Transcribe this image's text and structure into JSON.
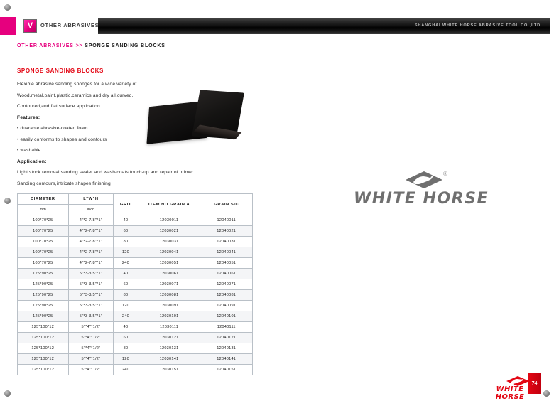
{
  "header": {
    "tab_icon_letter": "V",
    "tab_label": "OTHER ABRASIVES",
    "company": "SHANGHAI WHITE HORSE ABRASIVE TOOL CO.,LTD"
  },
  "breadcrumb": {
    "parent": "OTHER ABRASIVES",
    "separator": ">>",
    "current": "SPONGE SANDING BLOCKS"
  },
  "content": {
    "section_title": "SPONGE SANDING BLOCKS",
    "intro_line_1": "Flexible abrasive sanding sponges for a wide variety of",
    "intro_line_2": "Wood,metal,paint,plastic,ceramics and dry all,curved,",
    "intro_line_3": "Contoured,and flat surface application.",
    "features_heading": "Features:",
    "feature_1": "• duarable abrasive-coated foam",
    "feature_2": "• easily conforms to shapes and contours",
    "feature_3": "• washable",
    "application_heading": "Application:",
    "application_line_1": "Light stock removal,sanding sealer and wash-coats touch-up and repair of primer",
    "application_line_2": "Sanding contours,intricate shapes finishing"
  },
  "table": {
    "headers": [
      "DIAMETER",
      "L\"W\"H",
      "GRIT",
      "ITEM.NO.GRAIN  A",
      "GRAIN SIC"
    ],
    "subheaders": [
      "mm",
      "inch"
    ],
    "rows": [
      [
        "100*70*25",
        "4\"*2-7/8\"*1\"",
        "40",
        "12030011",
        "12040011"
      ],
      [
        "100*70*25",
        "4\"*2-7/8\"*1\"",
        "60",
        "12030021",
        "12040021"
      ],
      [
        "100*70*25",
        "4\"*2-7/8\"*1\"",
        "80",
        "12030031",
        "12040031"
      ],
      [
        "100*70*25",
        "4\"*2-7/8\"*1\"",
        "120",
        "12030041",
        "12040041"
      ],
      [
        "100*70*25",
        "4\"*2-7/8\"*1\"",
        "240",
        "12030051",
        "12040051"
      ],
      [
        "125*90*25",
        "5\"*3-3/5\"*1\"",
        "40",
        "12030061",
        "12040061"
      ],
      [
        "125*90*25",
        "5\"*3-3/5\"*1\"",
        "60",
        "12030071",
        "12040071"
      ],
      [
        "125*90*25",
        "5\"*3-3/5\"*1\"",
        "80",
        "12030081",
        "12040081"
      ],
      [
        "125*90*25",
        "5\"*3-3/5\"*1\"",
        "120",
        "12030091",
        "12040091"
      ],
      [
        "125*90*25",
        "5\"*3-3/5\"*1\"",
        "240",
        "12030101",
        "12040101"
      ],
      [
        "125*100*12",
        "5\"*4\"*1/2\"",
        "40",
        "12030111",
        "12040111"
      ],
      [
        "125*100*12",
        "5\"*4\"*1/2\"",
        "60",
        "12030121",
        "12040121"
      ],
      [
        "125*100*12",
        "5\"*4\"*1/2\"",
        "80",
        "12030131",
        "12040131"
      ],
      [
        "125*100*12",
        "5\"*4\"*1/2\"",
        "120",
        "12030141",
        "12040141"
      ],
      [
        "125*100*12",
        "5\"*4\"*1/2\"",
        "240",
        "12030151",
        "12040151"
      ]
    ]
  },
  "brand": {
    "wordmark": "WHITE HORSE",
    "registered": "®"
  },
  "footer": {
    "wordmark": "WHITE HORSE",
    "registered": "®",
    "page_number": "74"
  },
  "colors": {
    "magenta": "#e6007e",
    "red": "#e30613",
    "bar_dark": "#111111",
    "table_border": "#b9c0c7"
  }
}
